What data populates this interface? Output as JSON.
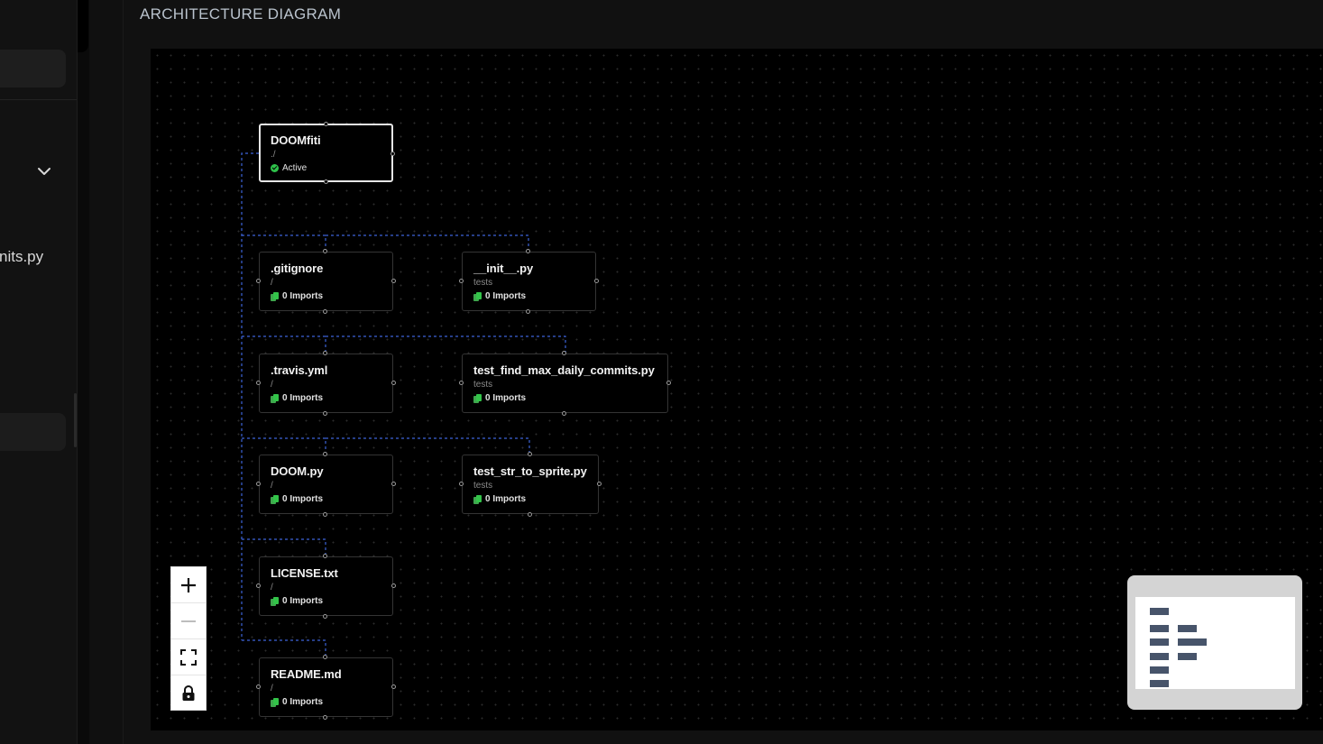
{
  "header": {
    "title": "ARCHITECTURE DIAGRAM"
  },
  "sidebar": {
    "file_label": "nits.py",
    "chevron_icon": "chevron-down-icon"
  },
  "nodes": [
    {
      "id": "root",
      "name": "DOOMfiti",
      "path": "./",
      "status": "Active"
    },
    {
      "id": "gitignore",
      "name": ".gitignore",
      "path": "/",
      "imports": "0 Imports"
    },
    {
      "id": "init",
      "name": "__init__.py",
      "path": "tests",
      "imports": "0 Imports"
    },
    {
      "id": "travis",
      "name": ".travis.yml",
      "path": "/",
      "imports": "0 Imports"
    },
    {
      "id": "test_find",
      "name": "test_find_max_daily_commits.py",
      "path": "tests",
      "imports": "0 Imports"
    },
    {
      "id": "doom",
      "name": "DOOM.py",
      "path": "/",
      "imports": "0 Imports"
    },
    {
      "id": "test_str",
      "name": "test_str_to_sprite.py",
      "path": "tests",
      "imports": "0 Imports"
    },
    {
      "id": "license",
      "name": "LICENSE.txt",
      "path": "/",
      "imports": "0 Imports"
    },
    {
      "id": "readme",
      "name": "README.md",
      "path": "/",
      "imports": "0 Imports"
    }
  ],
  "controls": {
    "zoom_in": "plus-icon",
    "zoom_out": "minus-icon",
    "fit_view": "fit-view-icon",
    "lock": "lock-icon"
  },
  "colors": {
    "edge": "#3d63d9",
    "status": "#2ec24a",
    "imports_icon": "#33c449",
    "minimap_node": "#47546a"
  }
}
